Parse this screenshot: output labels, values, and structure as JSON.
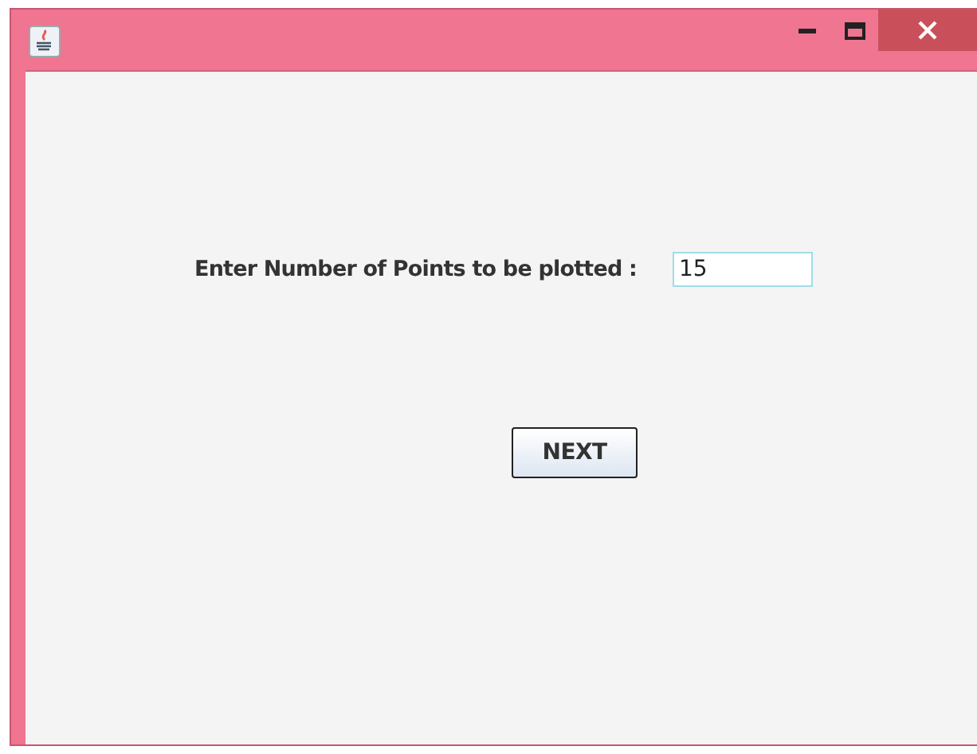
{
  "form": {
    "label": "Enter Number of Points to be plotted :",
    "value": "15"
  },
  "buttons": [
    "NEXT"
  ]
}
